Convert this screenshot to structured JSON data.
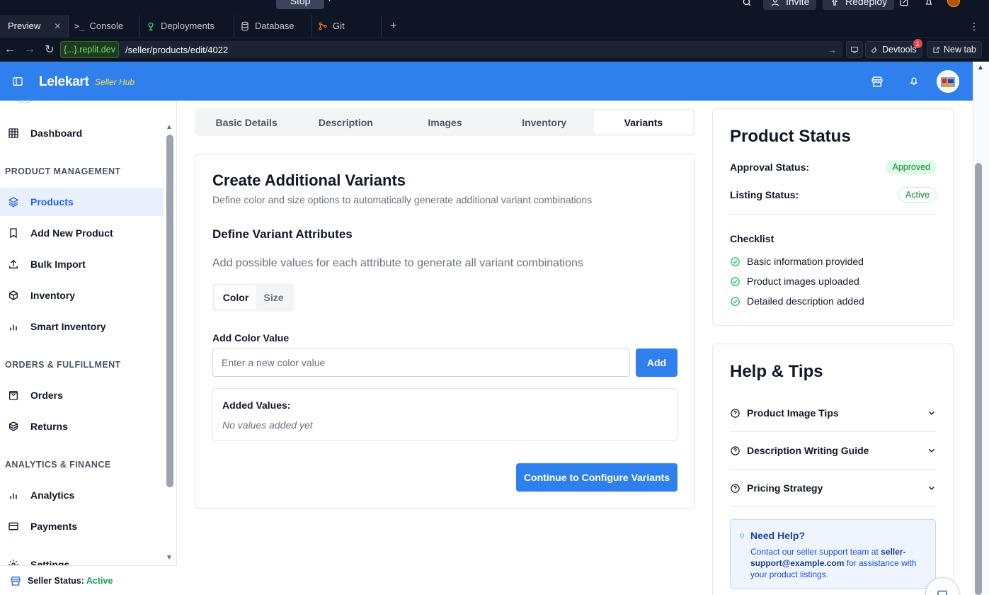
{
  "ide": {
    "stop_label": "Stop",
    "invite_label": "Invite",
    "redeploy_label": "Redeploy",
    "tabs": [
      {
        "label": "Preview",
        "icon": "monitor-icon",
        "active": true
      },
      {
        "label": "Console",
        "icon": "terminal-icon",
        "active": false
      },
      {
        "label": "Deployments",
        "icon": "deployments-icon",
        "active": false
      },
      {
        "label": "Database",
        "icon": "database-icon",
        "active": false
      },
      {
        "label": "Git",
        "icon": "git-icon",
        "active": false
      }
    ],
    "url_domain": "{...}.replit.dev",
    "url_path": "/seller/products/edit/4022",
    "devtools_label": "Devtools",
    "devtools_badge": "1",
    "newtab_label": "New tab"
  },
  "header": {
    "brand": "Lelekart",
    "brand_sub": "Seller Hub",
    "accent": "#2f80ed"
  },
  "sidebar": {
    "items": [
      {
        "label": "Dashboard",
        "icon": "grid-icon"
      },
      {
        "label": "Products",
        "icon": "layers-icon",
        "active": true
      },
      {
        "label": "Add New Product",
        "icon": "bookmark-icon"
      },
      {
        "label": "Bulk Import",
        "icon": "upload-icon"
      },
      {
        "label": "Inventory",
        "icon": "box-icon"
      },
      {
        "label": "Smart Inventory",
        "icon": "bar-chart-icon"
      },
      {
        "label": "Orders",
        "icon": "bag-icon"
      },
      {
        "label": "Returns",
        "icon": "package-return-icon"
      },
      {
        "label": "Analytics",
        "icon": "bar-chart-icon"
      },
      {
        "label": "Payments",
        "icon": "credit-card-icon"
      },
      {
        "label": "Settings",
        "icon": "gear-icon"
      }
    ],
    "sections": [
      "PRODUCT MANAGEMENT",
      "ORDERS & FULFILLMENT",
      "ANALYTICS & FINANCE"
    ],
    "footer_label": "Seller Status:",
    "footer_value": "Active"
  },
  "tabs": [
    "Basic Details",
    "Description",
    "Images",
    "Inventory",
    "Variants"
  ],
  "main": {
    "title": "Create Additional Variants",
    "subtitle": "Define color and size options to automatically generate additional variant combinations",
    "attr_title": "Define Variant Attributes",
    "attr_hint": "Add possible values for each attribute to generate all variant combinations",
    "seg_color": "Color",
    "seg_size": "Size",
    "input_label": "Add Color Value",
    "input_placeholder": "Enter a new color value",
    "add_label": "Add",
    "values_title": "Added Values:",
    "values_empty": "No values added yet",
    "continue_label": "Continue to Configure Variants"
  },
  "status": {
    "title": "Product Status",
    "approval_label": "Approval Status:",
    "approval_value": "Approved",
    "listing_label": "Listing Status:",
    "listing_value": "Active",
    "checklist_title": "Checklist",
    "checklist": [
      "Basic information provided",
      "Product images uploaded",
      "Detailed description added"
    ]
  },
  "help": {
    "title": "Help & Tips",
    "items": [
      "Product Image Tips",
      "Description Writing Guide",
      "Pricing Strategy"
    ],
    "box_title": "Need Help?",
    "box_text_pre": "Contact our seller support team at ",
    "box_email": "seller-support@example.com",
    "box_text_post": " for assistance with your product listings."
  }
}
